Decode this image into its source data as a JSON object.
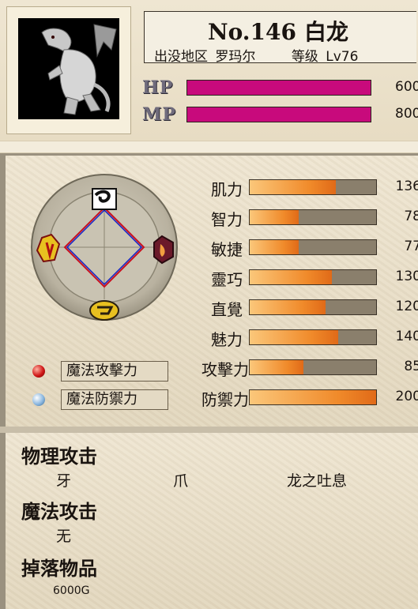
{
  "monster": {
    "number_label": "No.146",
    "name": "白龙",
    "area_label": "出没地区",
    "area": "罗玛尔",
    "level_label": "等级",
    "level": "Lv76"
  },
  "hp": {
    "label": "HP",
    "value": "600",
    "fill_fraction": 1.0,
    "color": "#c80a7c"
  },
  "mp": {
    "label": "MP",
    "value": "800",
    "fill_fraction": 1.0,
    "color": "#c80a7c"
  },
  "stats": [
    {
      "label": "肌力",
      "value": "136",
      "fill_fraction": 0.68
    },
    {
      "label": "智力",
      "value": "78",
      "fill_fraction": 0.39
    },
    {
      "label": "敏捷",
      "value": "77",
      "fill_fraction": 0.385
    },
    {
      "label": "靈巧",
      "value": "130",
      "fill_fraction": 0.65
    },
    {
      "label": "直覺",
      "value": "120",
      "fill_fraction": 0.6
    },
    {
      "label": "魅力",
      "value": "140",
      "fill_fraction": 0.7
    },
    {
      "label": "攻擊力",
      "value": "85",
      "fill_fraction": 0.425
    },
    {
      "label": "防禦力",
      "value": "200",
      "fill_fraction": 1.0
    }
  ],
  "tags": {
    "magic_attack": "魔法攻擊力",
    "magic_defense": "魔法防禦力"
  },
  "element_wheel": {
    "icons": [
      "wind-element-icon",
      "fire-element-icon",
      "water-element-icon",
      "earth-element-icon"
    ],
    "colors": {
      "diamond_outer": "#c81020",
      "diamond_inner": "#1020c8"
    }
  },
  "physical_attack": {
    "title": "物理攻击",
    "items": [
      "牙",
      "爪",
      "龙之吐息"
    ]
  },
  "magic_attack": {
    "title": "魔法攻击",
    "items": [
      "无"
    ]
  },
  "drops": {
    "title": "掉落物品",
    "items": [
      "6000G"
    ]
  }
}
